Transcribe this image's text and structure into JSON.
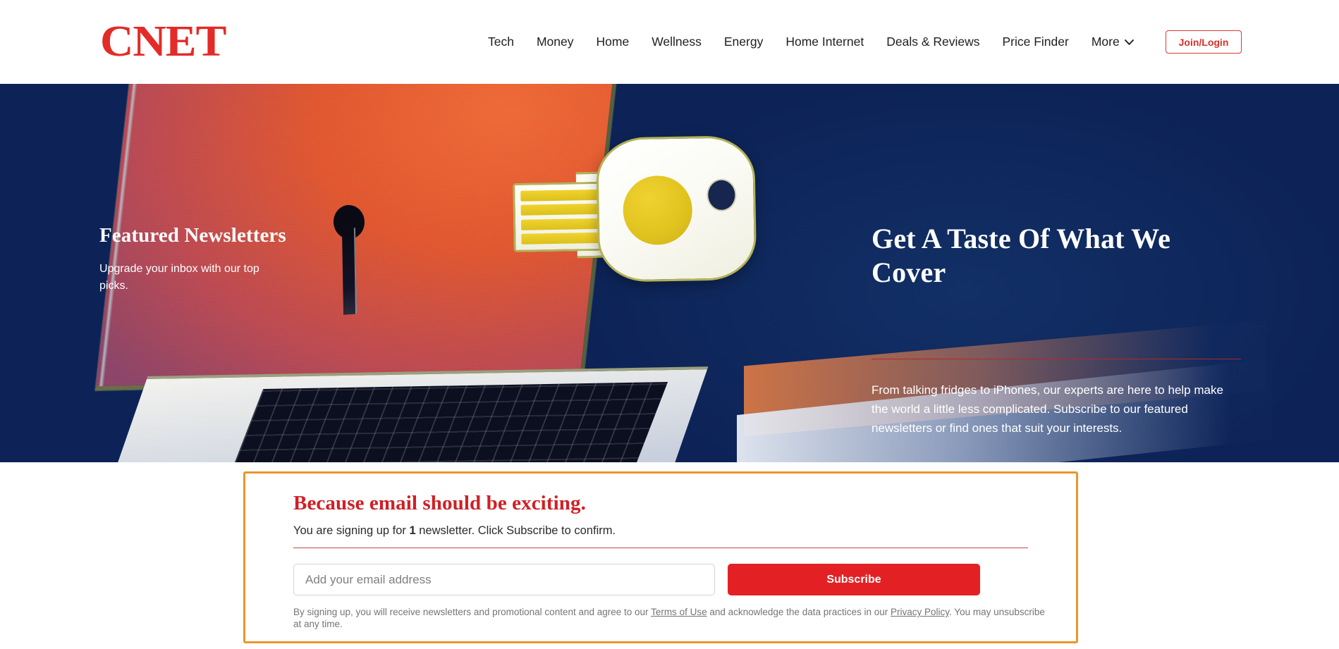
{
  "header": {
    "logo_text": "CNET",
    "nav_items": [
      {
        "label": "Tech"
      },
      {
        "label": "Money"
      },
      {
        "label": "Home"
      },
      {
        "label": "Wellness"
      },
      {
        "label": "Energy"
      },
      {
        "label": "Home Internet"
      },
      {
        "label": "Deals & Reviews"
      },
      {
        "label": "Price Finder"
      }
    ],
    "more_label": "More",
    "more_icon": "chevron-down-icon",
    "join_login_label": "Join/Login"
  },
  "hero": {
    "eyebrow_title": "Featured Newsletters",
    "eyebrow_sub": "Upgrade your inbox with our top picks.",
    "headline": "Get A Taste Of What We Cover",
    "body": "From talking fridges to iPhones, our experts are here to help make the world a little less complicated. Subscribe to our featured newsletters or find ones that suit your interests.",
    "illustration": "laptop-with-security-key-illustration",
    "background_color": "#0d2357",
    "rule_color": "#b0282a"
  },
  "subscribe_card": {
    "title": "Because email should be exciting.",
    "status_prefix": "You are signing up for ",
    "status_count": "1",
    "status_suffix": " newsletter. Click Subscribe to confirm.",
    "email_placeholder": "Add your email address",
    "email_value": "",
    "subscribe_label": "Subscribe",
    "legal_part1": "By signing up, you will receive newsletters and promotional content and agree to our ",
    "legal_link1": "Terms of Use",
    "legal_part2": " and acknowledge the data practices in our ",
    "legal_link2": "Privacy Policy",
    "legal_part3": ". You may unsubscribe at any time.",
    "border_color": "#e8962f",
    "title_color": "#cf2026",
    "button_color": "#e32124"
  }
}
